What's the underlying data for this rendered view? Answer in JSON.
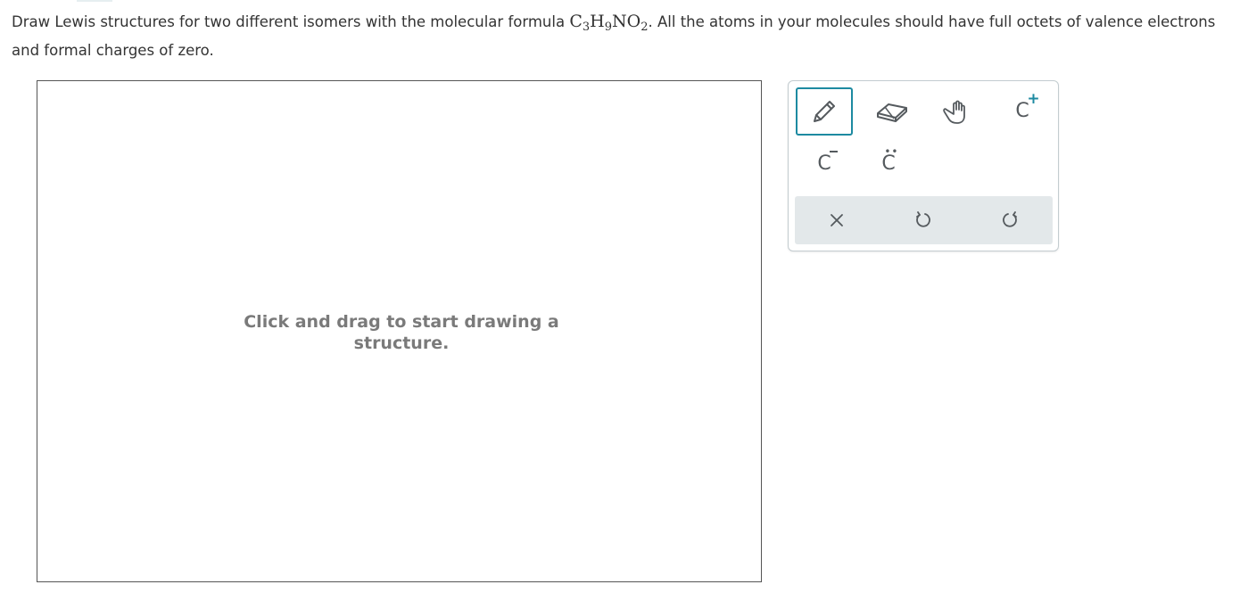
{
  "question": {
    "text_before": "Draw Lewis structures for two different isomers with the molecular formula ",
    "formula": {
      "c": "C",
      "c_count": "3",
      "h": "H",
      "h_count": "9",
      "no": "NO",
      "o_count": "2"
    },
    "text_after": ". All the atoms in your molecules should have full octets of valence electrons and formal charges of zero."
  },
  "canvas": {
    "hint_line1": "Click and drag to start drawing a",
    "hint_line2": "structure."
  },
  "toolbar": {
    "tools": [
      {
        "name": "pencil-tool",
        "icon": "pencil-icon",
        "selected": true
      },
      {
        "name": "eraser-tool",
        "icon": "eraser-icon",
        "selected": false
      },
      {
        "name": "move-tool",
        "icon": "hand-icon",
        "selected": false
      },
      {
        "name": "positive-charge-tool",
        "icon": "c-plus-icon",
        "label": "C",
        "badge": "+"
      },
      {
        "name": "negative-charge-tool",
        "icon": "c-minus-icon",
        "label": "C"
      },
      {
        "name": "lone-pair-tool",
        "icon": "c-lone-pair-icon",
        "label": "C"
      }
    ],
    "actions": [
      {
        "name": "clear-button",
        "icon": "close-icon"
      },
      {
        "name": "undo-button",
        "icon": "undo-icon"
      },
      {
        "name": "redo-button",
        "icon": "redo-icon"
      }
    ],
    "accent_color": "#1d8aa1",
    "icon_color": "#555a5e",
    "action_bar_color": "#e3e8ea"
  }
}
